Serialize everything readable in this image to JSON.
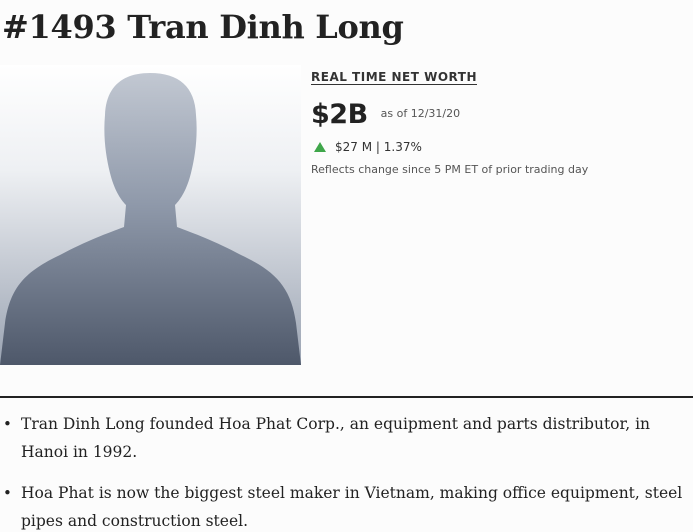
{
  "header": {
    "title": "#1493 Tran Dinh Long"
  },
  "profile": {
    "photo_icon": "person-silhouette-icon",
    "photo_gradient_top": "#c2c8d2",
    "photo_gradient_bottom": "#4e586a"
  },
  "net_worth": {
    "label": "REAL TIME NET WORTH",
    "value": "$2B",
    "as_of": "as of 12/31/20",
    "change_icon": "up-arrow-icon",
    "change": "$27 M | 1.37%",
    "change_color": "#3fa64a",
    "note": "Reflects change since 5 PM ET of prior trading day"
  },
  "bio": {
    "bullet": "•",
    "items": [
      "Tran Dinh Long founded Hoa Phat Corp., an equipment and parts distributor, in Hanoi in 1992.",
      "Hoa Phat is now the biggest steel maker in Vietnam, making office equipment, steel pipes and construction steel."
    ]
  }
}
